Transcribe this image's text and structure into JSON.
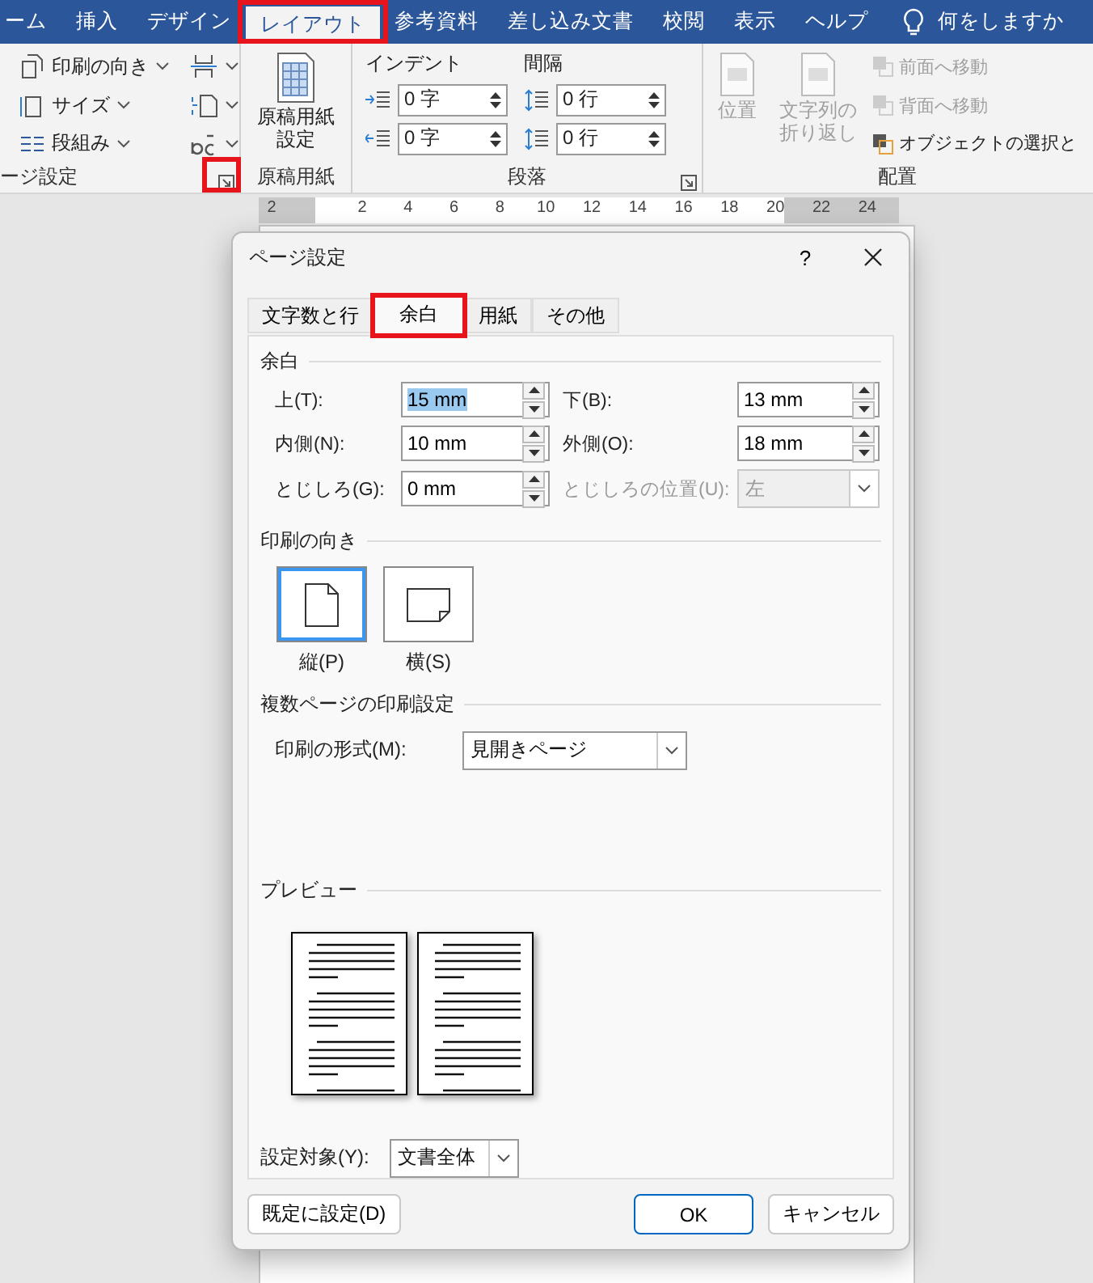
{
  "ribbon_tabs": [
    {
      "label": "ーム",
      "selected": false,
      "highlighted": false
    },
    {
      "label": "挿入",
      "selected": false,
      "highlighted": false
    },
    {
      "label": "デザイン",
      "selected": false,
      "highlighted": false
    },
    {
      "label": "レイアウト",
      "selected": true,
      "highlighted": true
    },
    {
      "label": "参考資料",
      "selected": false,
      "highlighted": false
    },
    {
      "label": "差し込み文書",
      "selected": false,
      "highlighted": false
    },
    {
      "label": "校閲",
      "selected": false,
      "highlighted": false
    },
    {
      "label": "表示",
      "selected": false,
      "highlighted": false
    },
    {
      "label": "ヘルプ",
      "selected": false,
      "highlighted": false
    }
  ],
  "tell_me": "何をしますか",
  "page_setup_group": {
    "label": "ージ設定",
    "launcher_highlighted": true,
    "commands": [
      {
        "label": "印刷の向き"
      },
      {
        "label": "サイズ"
      },
      {
        "label": "段組み"
      }
    ]
  },
  "genko_group": {
    "label": "原稿用紙",
    "button": "原稿用紙設定"
  },
  "paragraph_group": {
    "label": "段落",
    "indent_title": "インデント",
    "spacing_title": "間隔",
    "indent": [
      "0 字",
      "0 字"
    ],
    "spacing": [
      "0 行",
      "0 行"
    ]
  },
  "arrange_group": {
    "label": "配置",
    "big_commands": [
      {
        "label": "位置",
        "disabled": true
      },
      {
        "label": "文字列の折り返し",
        "disabled": true
      }
    ],
    "commands": [
      {
        "label": "前面へ移動",
        "disabled": true
      },
      {
        "label": "背面へ移動",
        "disabled": true
      },
      {
        "label": "オブジェクトの選択と",
        "disabled": false
      }
    ]
  },
  "ruler": {
    "ticks": [
      "2",
      "2",
      "4",
      "6",
      "8",
      "10",
      "12",
      "14",
      "16",
      "18",
      "20",
      "22",
      "24"
    ]
  },
  "dialog": {
    "title": "ページ設定",
    "help": "?",
    "tabs": [
      {
        "label": "文字数と行",
        "selected": false,
        "highlighted": false
      },
      {
        "label": "余白",
        "selected": true,
        "highlighted": true
      },
      {
        "label": "用紙",
        "selected": false,
        "highlighted": false
      },
      {
        "label": "その他",
        "selected": false,
        "highlighted": false
      }
    ],
    "margins": {
      "title": "余白",
      "fields": [
        {
          "label": "上(T):",
          "value": "15 mm",
          "text_selected": true
        },
        {
          "label": "下(B):",
          "value": "13 mm",
          "text_selected": false
        },
        {
          "label": "内側(N):",
          "value": "10 mm",
          "text_selected": false
        },
        {
          "label": "外側(O):",
          "value": "18 mm",
          "text_selected": false
        },
        {
          "label": "とじしろ(G):",
          "value": "0 mm",
          "text_selected": false
        }
      ],
      "gutter_position": {
        "label": "とじしろの位置(U):",
        "value": "左",
        "disabled": true
      }
    },
    "orientation": {
      "title": "印刷の向き",
      "options": [
        {
          "label": "縦(P)",
          "kind": "portrait",
          "selected": true
        },
        {
          "label": "横(S)",
          "kind": "landscape",
          "selected": false
        }
      ]
    },
    "multiple_pages": {
      "title": "複数ページの印刷設定",
      "label": "印刷の形式(M):",
      "value": "見開きページ"
    },
    "preview": {
      "title": "プレビュー"
    },
    "apply_to": {
      "label": "設定対象(Y):",
      "value": "文書全体"
    },
    "buttons": [
      {
        "label": "既定に設定(D)",
        "default": false
      },
      {
        "label": "OK",
        "default": true
      },
      {
        "label": "キャンセル",
        "default": false
      }
    ]
  }
}
